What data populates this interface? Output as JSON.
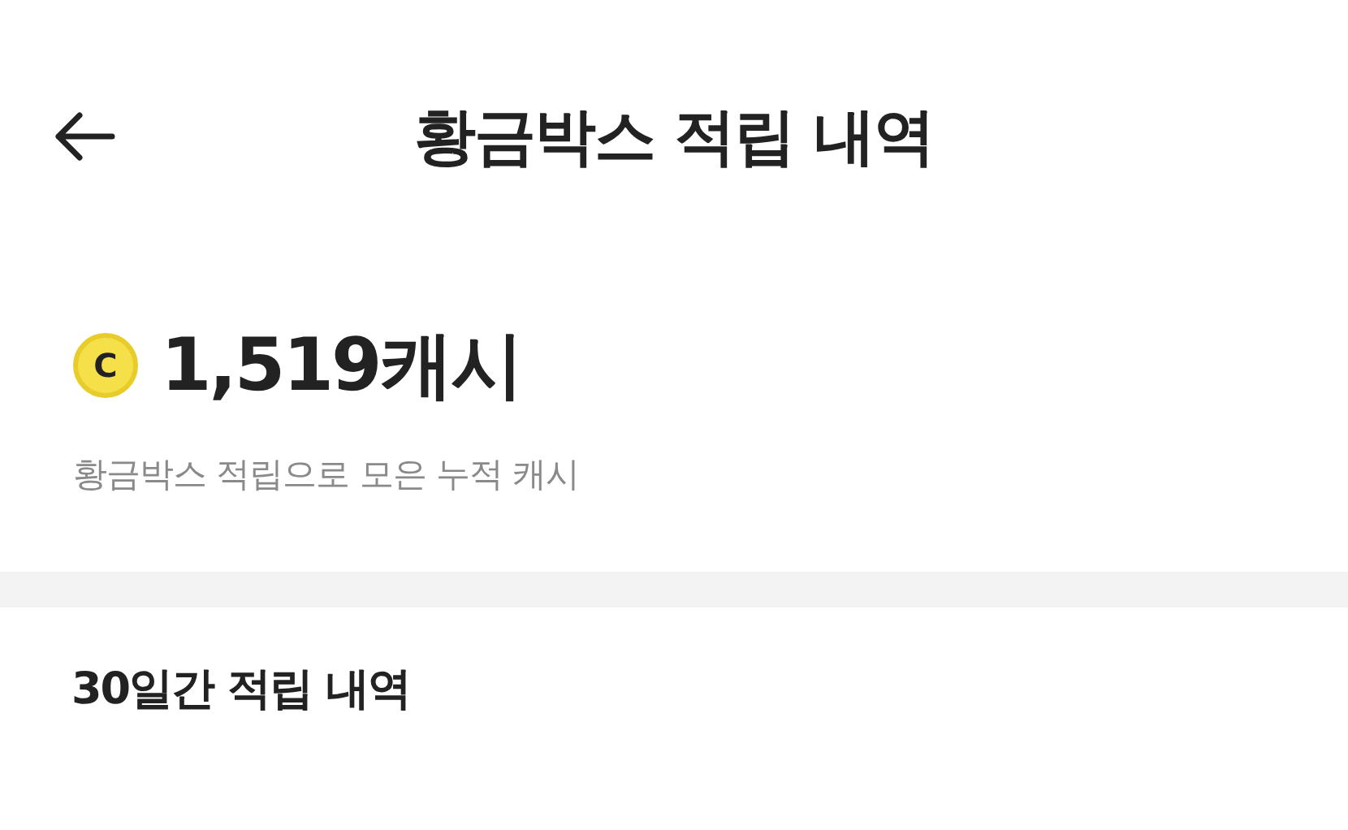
{
  "header": {
    "title": "황금박스 적립 내역"
  },
  "summary": {
    "coin_symbol": "C",
    "amount": "1,519캐시",
    "caption": "황금박스 적립으로 모은 누적 캐시"
  },
  "history": {
    "title": "30일간 적립 내역"
  }
}
